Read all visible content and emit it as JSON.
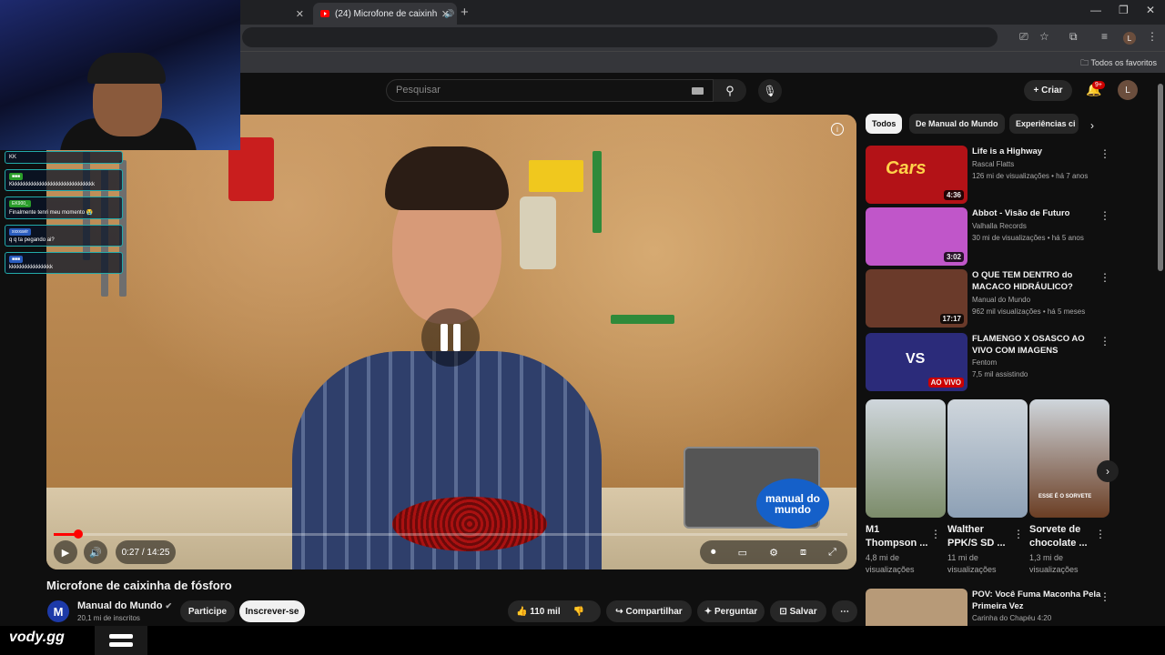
{
  "browser": {
    "active_tab_title": "(24) Microfone de caixinh",
    "bookmarks_folder": "Todos os favoritos",
    "profile_initial": "L"
  },
  "header": {
    "search_placeholder": "Pesquisar",
    "create_label": "Criar",
    "notifications_badge": "9+",
    "avatar_initial": "L"
  },
  "chat": {
    "messages": [
      {
        "user": "",
        "text": "KK"
      },
      {
        "user": "",
        "text": "Kkkkkkkkkkkkkkkkkkkkkkkkkkkkkkk"
      },
      {
        "user": "EK900_",
        "text": "Finalmente tenri meu momento 😭"
      },
      {
        "user": "xxxxavir",
        "text": "q q ta pegando ai?"
      },
      {
        "user": "",
        "text": "kkkkkkkkkkkkkkkk"
      }
    ]
  },
  "player": {
    "time": "0:27 / 14:25",
    "progress_fraction": 0.031,
    "channel_logo_text": "manual do mundo"
  },
  "video": {
    "title": "Microfone de caixinha de fósforo",
    "channel": "Manual do Mundo",
    "channel_initial": "M",
    "subscribers": "20,1 mi de inscritos",
    "join_label": "Participe",
    "subscribe_label": "Inscrever-se",
    "likes": "110 mil",
    "share_label": "Compartilhar",
    "ask_label": "Perguntar",
    "save_label": "Salvar"
  },
  "chips": [
    "Todos",
    "De Manual do Mundo",
    "Experiências ci"
  ],
  "recommendations": [
    {
      "title": "Life is a Highway",
      "channel": "Rascal Flatts",
      "meta": "126 mi de visualizações • há 7 anos",
      "duration": "4:36",
      "thumb_text": "Cars",
      "thumb_color": "#b31217"
    },
    {
      "title": "Abbot - Visão de Futuro",
      "channel": "Valhalla Records",
      "meta": "30 mi de visualizações • há 5 anos",
      "duration": "3:02",
      "thumb_text": "",
      "thumb_color": "#c056c9"
    },
    {
      "title": "O QUE TEM DENTRO do MACACO HIDRÁULICO?",
      "channel": "Manual do Mundo",
      "meta": "962 mil visualizações • há 5 meses",
      "duration": "17:17",
      "thumb_text": "",
      "thumb_color": "#6a3a2a"
    },
    {
      "title": "FLAMENGO X OSASCO AO VIVO COM IMAGENS",
      "channel": "Fentom",
      "meta": "7,5 mil assistindo",
      "duration": "AO VIVO",
      "thumb_text": "VS",
      "thumb_color": "#2b2b7a"
    }
  ],
  "shorts": [
    {
      "title": "M1 Thompson ...",
      "views": "4,8 mi de visualizações",
      "thumb_color": "#7c8c6a"
    },
    {
      "title": "Walther PPK/S SD ...",
      "views": "11 mi de visualizações",
      "thumb_color": "#8da0b5"
    },
    {
      "title": "Sorvete de chocolate ...",
      "views": "1,3 mi de visualizações",
      "thumb_color": "#6b3e24",
      "overlay": "ESSE É O SORVETE"
    }
  ],
  "last_rec": {
    "title": "POV: Você Fuma Maconha Pela Primeira Vez",
    "channel": "Carinha do Chapéu 4:20"
  },
  "bottom": {
    "brand": "vody.gg"
  }
}
